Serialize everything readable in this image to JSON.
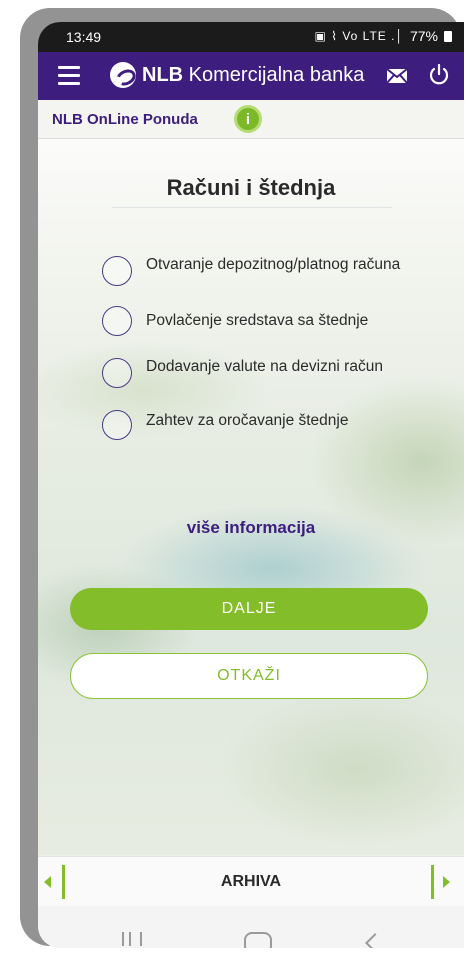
{
  "status_bar": {
    "time": "13:49",
    "icons": "▣ ⌇ Vo LTE .│",
    "battery": "77%"
  },
  "header": {
    "brand_bold": "NLB",
    "brand_rest": " Komercijalna banka",
    "color": "#3d1d7e"
  },
  "sub_header": {
    "title": "NLB OnLine Ponuda",
    "info_glyph": "i"
  },
  "main": {
    "title": "Računi i štednja",
    "options": [
      {
        "label": "Otvaranje depozitnog/platnog računa"
      },
      {
        "label": "Povlačenje sredstava sa štednje"
      },
      {
        "label": "Dodavanje valute na devizni račun"
      },
      {
        "label": "Zahtev za oročavanje štednje"
      }
    ],
    "more_info": "više informacija",
    "next_button": "DALJE",
    "cancel_button": "OTKAŽI"
  },
  "footer": {
    "archive_label": "ARHIVA"
  },
  "colors": {
    "accent_green": "#83bd2a",
    "brand_purple": "#3d1d7e"
  }
}
